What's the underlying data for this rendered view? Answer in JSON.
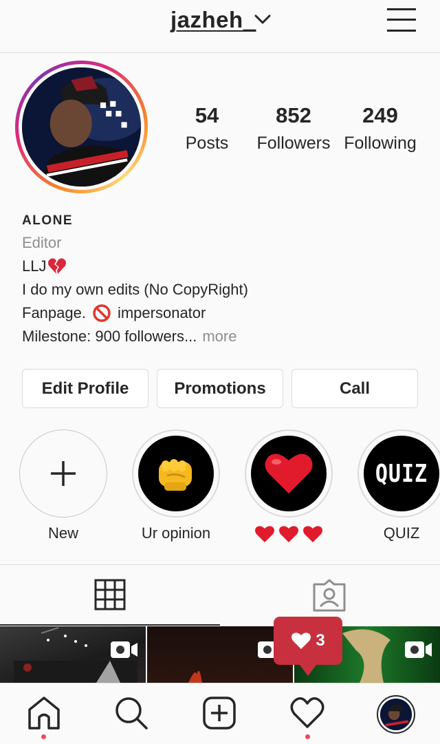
{
  "header": {
    "username": "jazheh_"
  },
  "profile": {
    "stats": [
      {
        "value": "54",
        "label": "Posts"
      },
      {
        "value": "852",
        "label": "Followers"
      },
      {
        "value": "249",
        "label": "Following"
      }
    ],
    "name": "ALONE",
    "category": "Editor",
    "bio_lines": [
      "LLJ",
      "I do my own edits (No CopyRight)",
      "Fanpage.",
      "impersonator",
      "Milestone: 900 followers..."
    ],
    "more_label": "more"
  },
  "actions": {
    "edit_profile": "Edit Profile",
    "promotions": "Promotions",
    "call": "Call"
  },
  "highlights": [
    {
      "label": "New",
      "icon": "plus-icon"
    },
    {
      "label": "Ur opinion",
      "icon": "fist-emoji"
    },
    {
      "label": "",
      "icon": "red-heart-emoji"
    },
    {
      "label": "QUIZ",
      "icon": "quiz-text",
      "cover_text": "QUIZ"
    }
  ],
  "tabs": [
    "grid-icon",
    "tagged-icon"
  ],
  "notification": {
    "likes": "3",
    "icon": "heart-icon",
    "color": "#c8303f"
  },
  "colors": {
    "accent": "#ed4956",
    "border": "#dbdbdb",
    "text": "#262626",
    "muted": "#8e8e8e"
  }
}
